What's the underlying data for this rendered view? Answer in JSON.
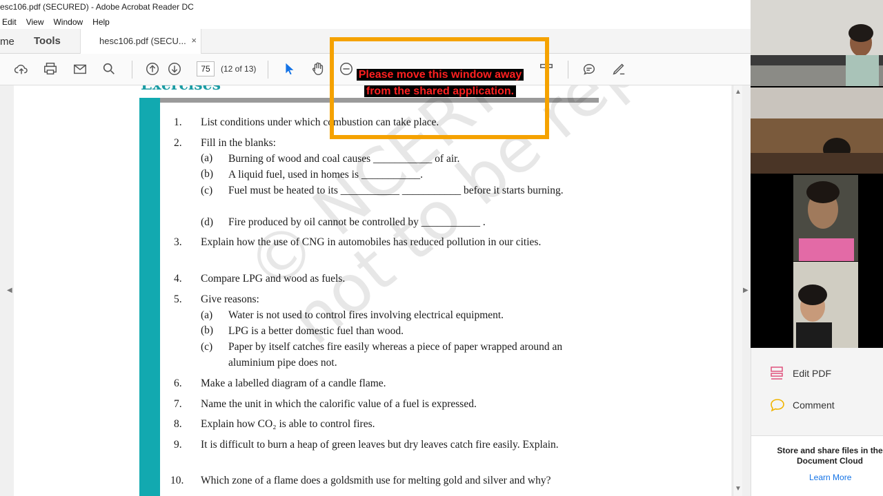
{
  "window": {
    "title": "esc106.pdf (SECURED) - Adobe Acrobat Reader DC"
  },
  "menu": [
    "Edit",
    "View",
    "Window",
    "Help"
  ],
  "tabs": {
    "home": "me",
    "tools": "Tools",
    "doc": "hesc106.pdf (SECU...",
    "close": "×"
  },
  "toolbar": {
    "page_value": "75",
    "page_count": "(12 of 13)"
  },
  "share_warning": {
    "line1": "Please move this window away",
    "line2": "from the shared application."
  },
  "document": {
    "heading": "Exercises",
    "watermark_line1": "© NCERT",
    "watermark_line2": "not to be republished",
    "items": [
      {
        "num": "1.",
        "text": "List conditions under which combustion can take place."
      },
      {
        "num": "2.",
        "text": "Fill in the blanks:"
      },
      {
        "num": "3.",
        "text": "Explain how the use of CNG in automobiles has reduced pollution in our cities."
      },
      {
        "num": "4.",
        "text": "Compare LPG and wood as fuels."
      },
      {
        "num": "5.",
        "text": "Give reasons:"
      },
      {
        "num": "6.",
        "text": "Make a labelled diagram of a candle flame."
      },
      {
        "num": "7.",
        "text": "Name the unit in which the calorific value of a fuel is expressed."
      },
      {
        "num": "8.",
        "text": "Explain how CO₂ is able to control fires."
      },
      {
        "num": "9.",
        "text": "It is difficult to burn a heap of green leaves but dry leaves catch fire easily. Explain."
      },
      {
        "num": "10.",
        "text": "Which zone of a flame does a goldsmith use for melting gold and silver and why?"
      }
    ],
    "sub2": [
      {
        "label": "(a)",
        "text": "Burning of wood and coal causes ___________ of air."
      },
      {
        "label": "(b)",
        "text": "A liquid fuel, used in homes is ___________."
      },
      {
        "label": "(c)",
        "text": "Fuel must be heated to its  ___________  ___________  before it starts burning."
      },
      {
        "label": "(d)",
        "text": "Fire produced by oil cannot be controlled by ___________ ."
      }
    ],
    "sub5": [
      {
        "label": "(a)",
        "text": "Water is not used to control fires involving electrical equipment."
      },
      {
        "label": "(b)",
        "text": "LPG is a better domestic fuel than wood."
      },
      {
        "label": "(c)",
        "text": "Paper by itself catches fire easily whereas a piece of paper wrapped around an aluminium pipe does not."
      }
    ]
  },
  "right_panel": {
    "edit_pdf": "Edit PDF",
    "comment": "Comment",
    "cloud_text": "Store and share files in the Document Cloud",
    "learn_more": "Learn More"
  }
}
